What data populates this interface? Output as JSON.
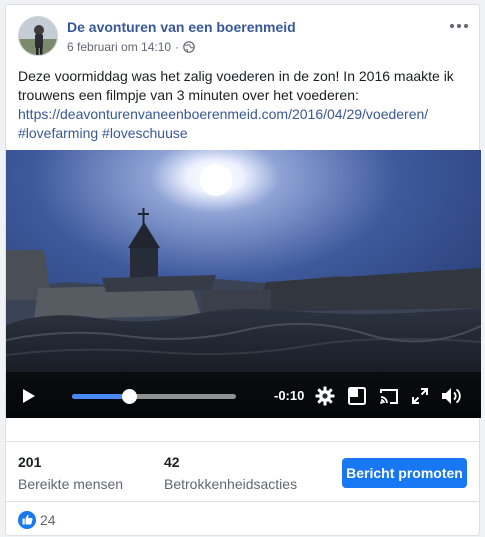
{
  "post": {
    "page_name": "De avonturen van een boerenmeid",
    "date": "6 februari om 14:10",
    "separator": "·",
    "text": "Deze voormiddag was het zalig voederen in de zon! In 2016 maakte ik trouwens een filmpje van 3 minuten over het voederen:",
    "link": "https://deavonturenvaneenboerenmeid.com/2016/04/29/voederen/",
    "hashtags": [
      "#lovefarming",
      "#loveschuuse"
    ]
  },
  "video": {
    "remaining_time": "-0:10",
    "progress": 0.35
  },
  "stats": {
    "reach_count": "201",
    "reach_label": "Bereikte mensen",
    "engagement_count": "42",
    "engagement_label": "Betrokkenheidsacties",
    "promote_label": "Bericht promoten"
  },
  "reactions": {
    "like_count": "24"
  },
  "icons": {
    "more": "more-options-icon",
    "privacy": "globe-icon",
    "play": "play-icon",
    "settings": "gear-icon",
    "pip": "picture-in-picture-icon",
    "cast": "cast-icon",
    "fullscreen": "fullscreen-icon",
    "volume": "volume-icon",
    "like": "thumbs-up-icon"
  },
  "colors": {
    "link": "#385898",
    "page_name": "#365899",
    "promote_button": "#1877f2",
    "progress": "#4a89f5"
  }
}
